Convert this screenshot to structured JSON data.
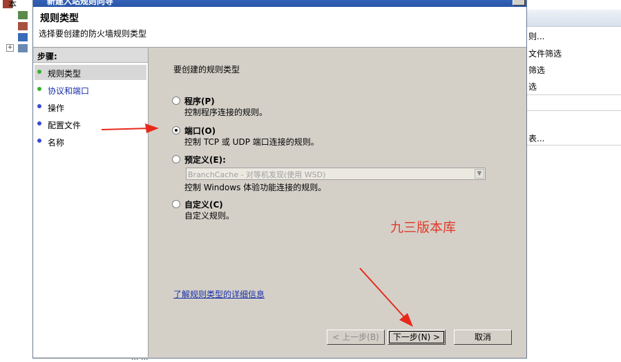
{
  "background": {
    "tree_label": "本",
    "actions": [
      "则...",
      "文件筛选",
      "筛选",
      "选",
      "表..."
    ],
    "bottom_strip": "...        ..."
  },
  "wizard": {
    "title": "新建入站规则向导",
    "header_title": "规则类型",
    "header_subtitle": "选择要创建的防火墙规则类型",
    "steps_heading": "步骤:",
    "steps": [
      {
        "label": "规则类型",
        "active": true,
        "dot_color": "#38b030"
      },
      {
        "label": "协议和端口",
        "active": false,
        "dot_color": "#38b030"
      },
      {
        "label": "操作",
        "active": false,
        "dot_color": "#3a4ad0"
      },
      {
        "label": "配置文件",
        "active": false,
        "dot_color": "#3a4ad0"
      },
      {
        "label": "名称",
        "active": false,
        "dot_color": "#3a4ad0"
      }
    ],
    "prompt": "要创建的规则类型",
    "options": [
      {
        "label": "程序(P)",
        "desc": "控制程序连接的规则。",
        "checked": false
      },
      {
        "label": "端口(O)",
        "desc": "控制 TCP 或 UDP 端口连接的规则。",
        "checked": true
      },
      {
        "label": "预定义(E):",
        "desc": "控制 Windows 体验功能连接的规则。",
        "checked": false
      },
      {
        "label": "自定义(C)",
        "desc": "自定义规则。",
        "checked": false
      }
    ],
    "predefined_select": "BranchCache - 对等机发现(使用 WSD)",
    "watermark": "九三版本库",
    "learn_more": "了解规则类型的详细信息",
    "buttons": {
      "back": "< 上一步(B)",
      "next": "下一步(N) >",
      "cancel": "取消"
    },
    "annotation_color": "#e8281c"
  }
}
